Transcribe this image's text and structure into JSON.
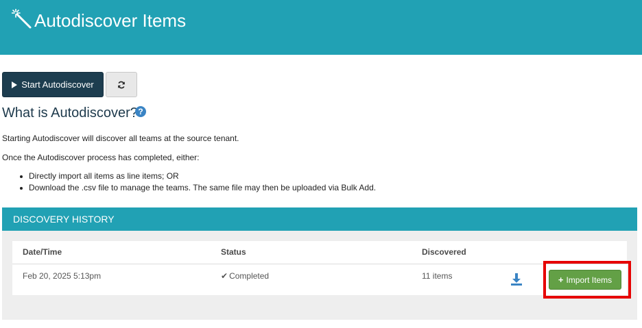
{
  "header": {
    "title": "Autodiscover Items",
    "icon": "magic-wand-icon"
  },
  "toolbar": {
    "start_label": "Start Autodiscover",
    "refresh_icon": "refresh-icon"
  },
  "info": {
    "title": "What is Autodiscover?",
    "help_glyph": "?",
    "paragraph1": "Starting Autodiscover will discover all teams at the source tenant.",
    "paragraph2": "Once the Autodiscover process has completed, either:",
    "bullets": [
      "Directly import all items as line items; OR",
      "Download the .csv file to manage the teams. The same file may then be uploaded via Bulk Add."
    ]
  },
  "history": {
    "title": "DISCOVERY HISTORY",
    "columns": [
      "Date/Time",
      "Status",
      "Discovered"
    ],
    "rows": [
      {
        "datetime": "Feb 20, 2025 5:13pm",
        "status": "Completed",
        "discovered": "11 items",
        "import_label": "Import Items"
      }
    ]
  },
  "colors": {
    "header": "#21a1b4",
    "start_button": "#1d3d4f",
    "import_button": "#63a046",
    "highlight": "#e60000"
  }
}
